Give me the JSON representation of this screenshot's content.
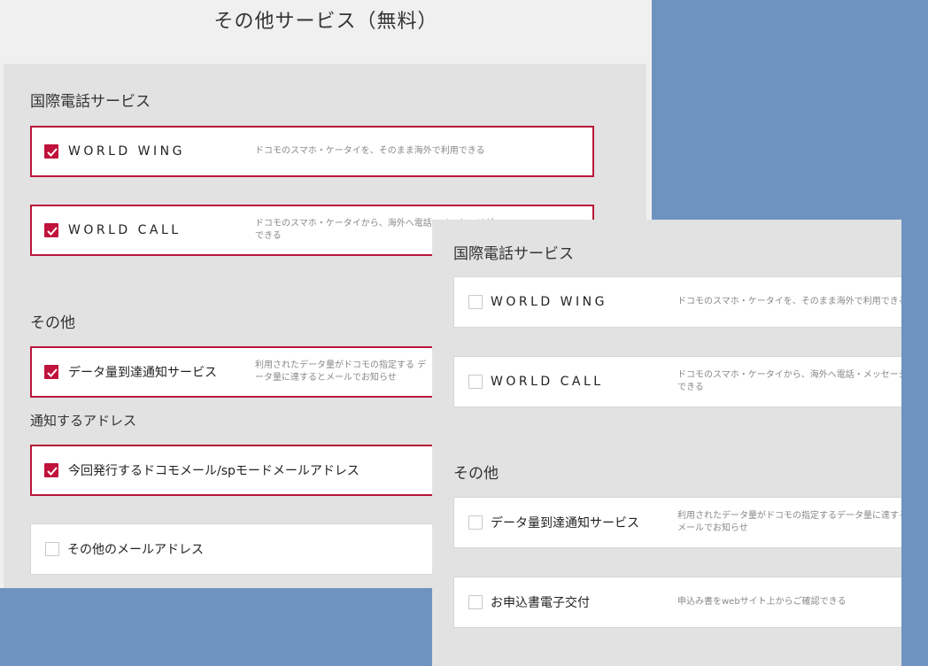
{
  "panel_a": {
    "title": "その他サービス（無料）",
    "section_international": "国際電話サービス",
    "world_wing": {
      "label": "WORLD WING",
      "desc": "ドコモのスマホ・ケータイを、そのまま海外で利用できる",
      "checked": true
    },
    "world_call": {
      "label": "WORLD CALL",
      "desc": "ドコモのスマホ・ケータイから、海外へ電話・メッセージができる",
      "checked": true
    },
    "section_other": "その他",
    "data_notice": {
      "label": "データ量到達通知サービス",
      "desc": "利用されたデータ量がドコモの指定する データ量に達するとメールでお知らせ",
      "checked": true
    },
    "notify_address_heading": "通知するアドレス",
    "address_docomo": {
      "label": "今回発行するドコモメール/spモードメールアドレス",
      "checked": true
    },
    "address_other": {
      "label": "その他のメールアドレス",
      "checked": false
    }
  },
  "panel_b": {
    "section_international": "国際電話サービス",
    "world_wing": {
      "label": "WORLD WING",
      "desc": "ドコモのスマホ・ケータイを、そのまま海外で利用できる",
      "checked": false
    },
    "world_call": {
      "label": "WORLD CALL",
      "desc": "ドコモのスマホ・ケータイから、海外へ電話・メッセージができる",
      "checked": false
    },
    "section_other": "その他",
    "data_notice": {
      "label": "データ量到達通知サービス",
      "desc": "利用されたデータ量がドコモの指定するデータ量に達するとメールでお知らせ",
      "checked": false
    },
    "e_application": {
      "label": "お申込書電子交付",
      "desc": "申込み書をwebサイト上からご確認できる",
      "checked": false
    }
  },
  "colors": {
    "accent": "#c0123a",
    "background": "#6f93c0"
  },
  "icons": {
    "checkbox_checked": "check-icon"
  }
}
